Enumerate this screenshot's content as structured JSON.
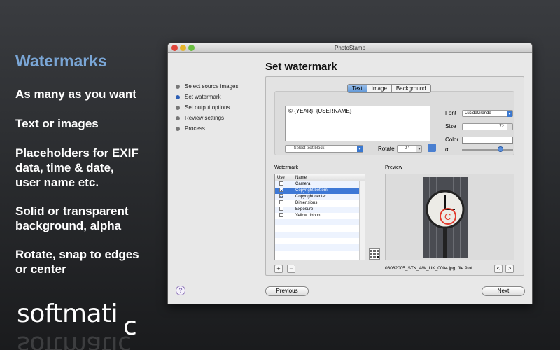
{
  "promo": {
    "title": "Watermarks",
    "lines": [
      "As many as you want",
      "Text or images",
      "Placeholders for EXIF",
      "data, time & date,",
      "user name etc.",
      "Solid or transparent",
      "background, alpha",
      "Rotate, snap to edges",
      "or center"
    ],
    "brand": "softmati",
    "brand_tail": "c"
  },
  "window": {
    "title": "PhotoStamp",
    "heading": "Set watermark"
  },
  "steps": [
    {
      "label": "Select source images",
      "active": false
    },
    {
      "label": "Set watermark",
      "active": true
    },
    {
      "label": "Set output options",
      "active": false
    },
    {
      "label": "Review settings",
      "active": false
    },
    {
      "label": "Process",
      "active": false
    }
  ],
  "tabs": [
    "Text",
    "Image",
    "Background"
  ],
  "text_panel": {
    "text_value": "© {YEAR}, {USERNAME}",
    "select_block": "--- Select text block",
    "rotate_label": "Rotate",
    "rotate_value": "0 °",
    "font_label": "Font",
    "font_value": "LucidaGrande",
    "size_label": "Size",
    "size_value": "72",
    "color_label": "Color",
    "alpha_label": "α",
    "alpha_value": 0.78,
    "color_value": "#ffffff"
  },
  "watermark_list": {
    "label": "Watermark",
    "col_use": "Use",
    "col_name": "Name",
    "rows": [
      {
        "name": "Camera",
        "checked": false,
        "selected": false
      },
      {
        "name": "Copyright bottom",
        "checked": true,
        "selected": true
      },
      {
        "name": "Copyright center",
        "checked": true,
        "selected": false
      },
      {
        "name": "Dimensions",
        "checked": false,
        "selected": false
      },
      {
        "name": "Exposure",
        "checked": false,
        "selected": false
      },
      {
        "name": "Yellow ribbon",
        "checked": false,
        "selected": false
      }
    ],
    "add": "+",
    "remove": "−"
  },
  "preview": {
    "label": "Preview",
    "file_info": "08082005_STK_AW_UK_0004.jpg, file 9 of",
    "prev": "<",
    "next": ">"
  },
  "footer": {
    "help": "?",
    "previous": "Previous",
    "next": "Next"
  },
  "colors": {
    "accent": "#3d78d6",
    "promo_title": "#7aa6d6",
    "watermark_red": "#e23b2e"
  }
}
